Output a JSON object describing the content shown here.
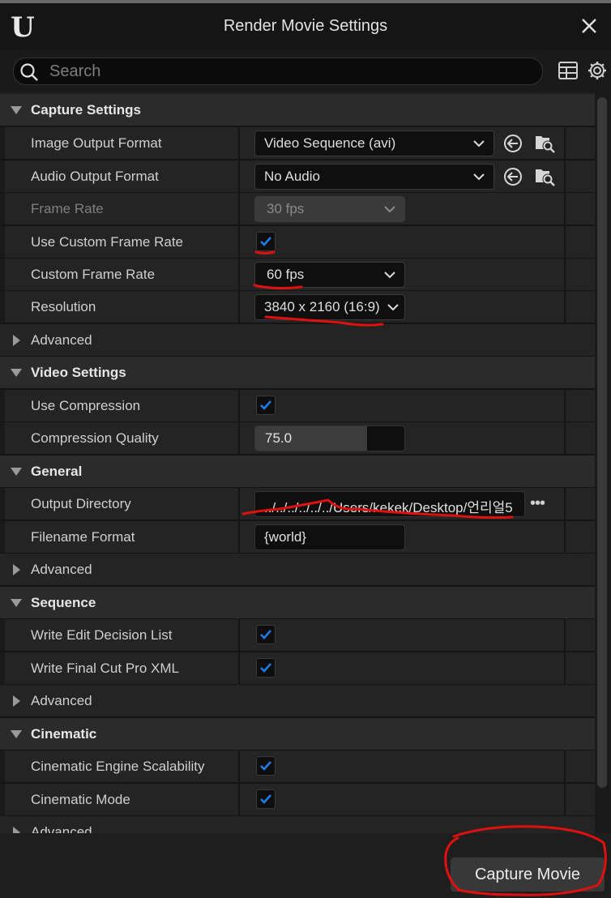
{
  "window": {
    "title": "Render Movie Settings"
  },
  "search": {
    "placeholder": "Search",
    "value": ""
  },
  "sections": {
    "capture": {
      "title": "Capture Settings",
      "image_output_format": {
        "label": "Image Output Format",
        "value": "Video Sequence (avi)"
      },
      "audio_output_format": {
        "label": "Audio Output Format",
        "value": "No Audio"
      },
      "frame_rate": {
        "label": "Frame Rate",
        "value": "30 fps"
      },
      "use_custom_frame_rate": {
        "label": "Use Custom Frame Rate",
        "checked": true
      },
      "custom_frame_rate": {
        "label": "Custom Frame Rate",
        "value": "60 fps"
      },
      "resolution": {
        "label": "Resolution",
        "value": "3840 x 2160 (16:9)"
      },
      "advanced": "Advanced"
    },
    "video": {
      "title": "Video Settings",
      "use_compression": {
        "label": "Use Compression",
        "checked": true
      },
      "compression_quality": {
        "label": "Compression Quality",
        "value": "75.0",
        "fraction": 0.75
      }
    },
    "general": {
      "title": "General",
      "output_directory": {
        "label": "Output Directory",
        "value": "../../../../../../Users/kekek/Desktop/언리얼5"
      },
      "filename_format": {
        "label": "Filename Format",
        "value": "{world}"
      },
      "advanced": "Advanced"
    },
    "sequence": {
      "title": "Sequence",
      "write_edl": {
        "label": "Write Edit Decision List",
        "checked": true
      },
      "write_fcp_xml": {
        "label": "Write Final Cut Pro XML",
        "checked": true
      },
      "advanced": "Advanced"
    },
    "cinematic": {
      "title": "Cinematic",
      "engine_scalability": {
        "label": "Cinematic Engine Scalability",
        "checked": true
      },
      "cinematic_mode": {
        "label": "Cinematic Mode",
        "checked": true
      },
      "advanced": "Advanced"
    }
  },
  "footer": {
    "capture_label": "Capture Movie"
  },
  "dots": "•••",
  "colors": {
    "accent": "#1e7ce8",
    "annotation": "#e01010"
  }
}
